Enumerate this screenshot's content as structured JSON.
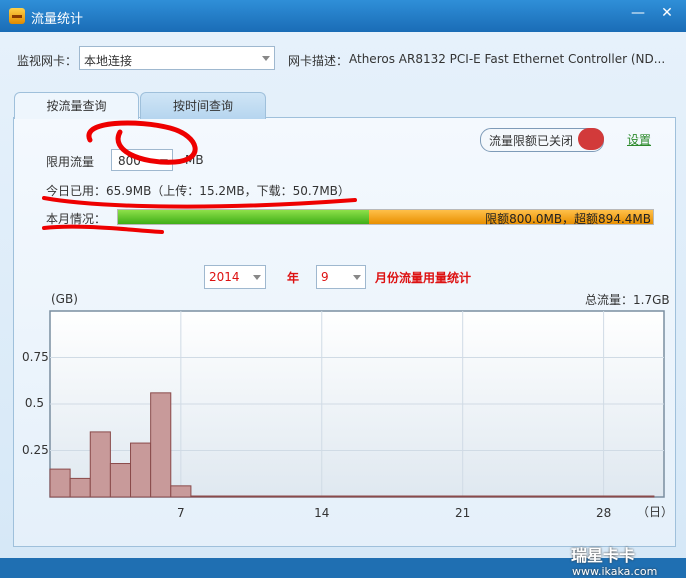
{
  "window": {
    "title": "流量统计",
    "min_glyph": "—",
    "close_glyph": "✕"
  },
  "nic": {
    "label": "监视网卡：",
    "selected": "本地连接",
    "desc_label": "网卡描述：",
    "desc": "Atheros AR8132 PCI-E Fast Ethernet Controller (ND..."
  },
  "tabs": [
    {
      "label": "按流量查询"
    },
    {
      "label": "按时间查询"
    }
  ],
  "limit": {
    "toggle_label": "流量限额已关闭",
    "settings": "设置",
    "label": "限用流量",
    "value": "800",
    "unit": "MB"
  },
  "today": {
    "text": "今日已用：65.9MB（上传：15.2MB，下载：50.7MB）"
  },
  "month": {
    "label": "本月情况：",
    "bar_text": "限额800.0MB，超额894.4MB",
    "fill_fraction": 0.47
  },
  "period": {
    "year": "2014",
    "year_label": "年",
    "month": "9",
    "stat_label": "月份流量用量统计"
  },
  "chart_labels": {
    "unit": "(GB)",
    "total": "总流量：1.7GB",
    "day_unit": "（日）"
  },
  "chart_data": {
    "type": "bar",
    "xlabel": "（日）",
    "ylabel": "(GB)",
    "ylim": [
      0,
      1.0
    ],
    "y_ticks": [
      "0.75",
      "0.5",
      "0.25"
    ],
    "x_ticks": [
      "7",
      "14",
      "21",
      "28"
    ],
    "days": [
      1,
      2,
      3,
      4,
      5,
      6,
      7,
      8,
      9,
      10,
      11,
      12,
      13,
      14,
      15,
      16,
      17,
      18,
      19,
      20,
      21,
      22,
      23,
      24,
      25,
      26,
      27,
      28,
      29,
      30
    ],
    "values": [
      0.15,
      0.1,
      0.35,
      0.18,
      0.29,
      0.56,
      0.06,
      0,
      0,
      0,
      0,
      0,
      0,
      0,
      0,
      0,
      0,
      0,
      0,
      0,
      0,
      0,
      0,
      0,
      0,
      0,
      0,
      0,
      0,
      0
    ],
    "grid": true
  },
  "watermark": {
    "brand": "瑞星卡卡",
    "url": "www.ikaka.com"
  },
  "colors": {
    "accent": "#1a6cb6",
    "bar": "#c89a9a",
    "bar_stroke": "#8a4a4a",
    "highlight": "#d11"
  }
}
